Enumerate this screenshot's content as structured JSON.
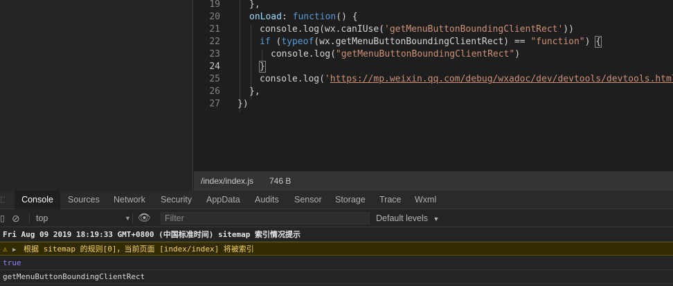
{
  "editor": {
    "lines": [
      {
        "num": "19",
        "tokens": [
          {
            "t": "p",
            "v": "},"
          }
        ]
      },
      {
        "num": "20",
        "tokens": [
          {
            "t": "key",
            "v": "onLoad"
          },
          {
            "t": "p",
            "v": ": "
          },
          {
            "t": "kw",
            "v": "function"
          },
          {
            "t": "p",
            "v": "() {"
          }
        ]
      },
      {
        "num": "21",
        "tokens": [
          {
            "t": "p",
            "v": "console.log(wx.canIUse("
          },
          {
            "t": "str",
            "v": "'getMenuButtonBoundingClientRect'"
          },
          {
            "t": "p",
            "v": "))"
          }
        ]
      },
      {
        "num": "22",
        "tokens": [
          {
            "t": "kw",
            "v": "if"
          },
          {
            "t": "p",
            "v": " ("
          },
          {
            "t": "kw",
            "v": "typeof"
          },
          {
            "t": "p",
            "v": "(wx.getMenuButtonBoundingClientRect) == "
          },
          {
            "t": "str",
            "v": "\"function\""
          },
          {
            "t": "p",
            "v": ") "
          },
          {
            "t": "hl",
            "v": "{"
          }
        ]
      },
      {
        "num": "23",
        "tokens": [
          {
            "t": "p",
            "v": "console.log("
          },
          {
            "t": "str",
            "v": "\"getMenuButtonBoundingClientRect\""
          },
          {
            "t": "p",
            "v": ")"
          }
        ]
      },
      {
        "num": "24",
        "tokens": [
          {
            "t": "hl",
            "v": "}"
          }
        ]
      },
      {
        "num": "25",
        "tokens": [
          {
            "t": "p",
            "v": "console.log("
          },
          {
            "t": "str",
            "v": "'"
          },
          {
            "t": "url",
            "v": "https://mp.weixin.qq.com/debug/wxadoc/dev/devtools/devtools.html"
          },
          {
            "t": "str",
            "v": "'"
          }
        ]
      },
      {
        "num": "26",
        "tokens": [
          {
            "t": "p",
            "v": "},"
          }
        ]
      },
      {
        "num": "27",
        "tokens": [
          {
            "t": "p",
            "v": "})"
          }
        ]
      }
    ]
  },
  "file_bar": {
    "path": "/index/index.js",
    "size": "746 B"
  },
  "devtools": {
    "tabs": [
      "Console",
      "Sources",
      "Network",
      "Security",
      "AppData",
      "Audits",
      "Sensor",
      "Storage",
      "Trace",
      "Wxml"
    ],
    "active_tab": "Console",
    "context": "top",
    "filter_placeholder": "Filter",
    "levels": "Default levels",
    "messages": {
      "info": "Fri Aug 09 2019 18:19:33 GMT+0800 (中国标准时间) sitemap 索引情况提示",
      "warn": "根据 sitemap 的规则[0]，当前页面 [index/index] 将被索引",
      "value": "true",
      "plain": "getMenuButtonBoundingClientRect"
    }
  },
  "icons": [
    "clear-console-icon",
    "eye-icon",
    "warning-icon",
    "expand-triangle-icon",
    "dropdown-arrow-icon"
  ],
  "colors": {
    "keyword": "#569cd6",
    "string": "#ce9178",
    "property": "#9cdcfe",
    "warning_bg": "#332b00",
    "value_true": "#9980ff"
  }
}
